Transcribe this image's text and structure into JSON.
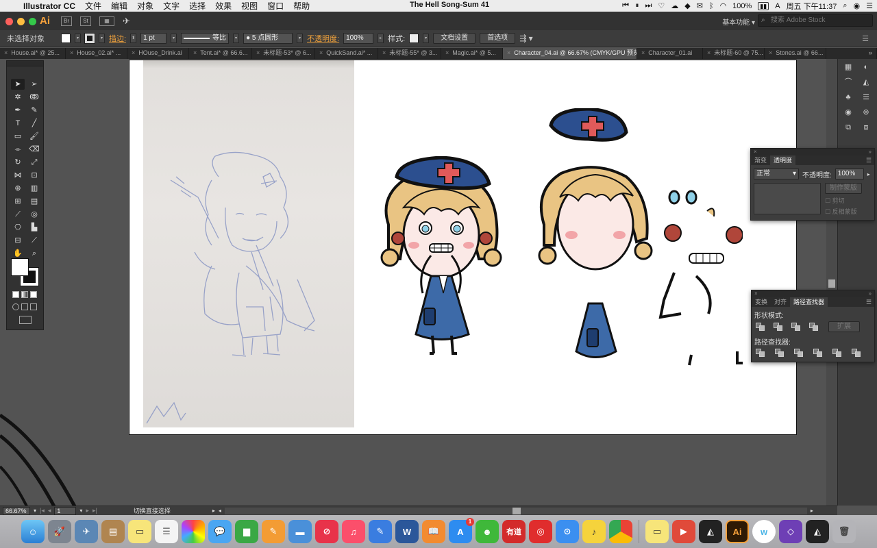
{
  "menubar": {
    "app_name": "Illustrator CC",
    "menus": [
      "文件",
      "编辑",
      "对象",
      "文字",
      "选择",
      "效果",
      "视图",
      "窗口",
      "帮助"
    ],
    "now_playing": "The Hell Song-Sum 41",
    "battery": "100%",
    "datetime": "周五 下午11:37"
  },
  "appbar": {
    "logo": "Ai",
    "st_label": "St",
    "workspace": "基本功能",
    "search_placeholder": "搜索 Adobe Stock"
  },
  "controlbar": {
    "selection": "未选择对象",
    "stroke_label": "描边:",
    "stroke_weight": "1 pt",
    "stroke_profile": "等比",
    "brush": "5 点圆形",
    "opacity_label": "不透明度:",
    "opacity_value": "100%",
    "style_label": "样式:",
    "doc_setup": "文档设置",
    "preferences": "首选项"
  },
  "tabs": [
    {
      "label": "House.ai* @ 25...",
      "active": false
    },
    {
      "label": "House_02.ai* ...",
      "active": false
    },
    {
      "label": "HOuse_Drink.ai",
      "active": false
    },
    {
      "label": "Tent.ai* @ 66.6...",
      "active": false
    },
    {
      "label": "未标题-53* @ 6...",
      "active": false
    },
    {
      "label": "QuickSand.ai* ...",
      "active": false
    },
    {
      "label": "未标题-55* @ 3...",
      "active": false
    },
    {
      "label": "Magic.ai* @ 5...",
      "active": false
    },
    {
      "label": "Character_04.ai @ 66.67% (CMYK/GPU 预览)",
      "active": true
    },
    {
      "label": "Character_01.ai",
      "active": false
    },
    {
      "label": "未标题-60 @ 75...",
      "active": false
    },
    {
      "label": "Stones.ai @ 66...",
      "active": false
    }
  ],
  "transparency_panel": {
    "tabs": [
      "渐变",
      "透明度"
    ],
    "blend_mode": "正常",
    "opacity_label": "不透明度:",
    "opacity_value": "100%",
    "make_mask": "制作蒙版",
    "clip": "剪切",
    "invert_mask": "反相蒙版"
  },
  "pathfinder_panel": {
    "tabs": [
      "变换",
      "对齐",
      "路径查找器"
    ],
    "shape_modes": "形状模式:",
    "expand": "扩展",
    "pathfinders": "路径查找器:"
  },
  "statusbar": {
    "zoom": "66.67%",
    "artboard": "1",
    "tool_hint": "切换直接选择"
  },
  "colors": {
    "accent_orange": "#f0a23c",
    "nurse_blue": "#2c4f8f",
    "hair_blonde": "#e9c483",
    "cross_red": "#e05a5a"
  },
  "dock": {
    "apps": [
      "finder-icon",
      "launchpad-icon",
      "preview-icon",
      "notes-icon",
      "stickies-icon",
      "reminders-icon",
      "photos-icon",
      "messages-icon",
      "numbers-icon",
      "pages-icon",
      "keynote-icon",
      "news-icon",
      "music-icon",
      "notes2-icon",
      "word-icon",
      "books-icon",
      "appstore-icon",
      "wechat-icon",
      "youdao-icon",
      "netease-icon",
      "safari-icon",
      "kuwo-icon",
      "chrome-icon",
      "stickies2-icon",
      "video-icon",
      "unity-icon",
      "illustrator-icon",
      "w-icon",
      "vs-icon",
      "unity2-icon",
      "trash-icon"
    ],
    "appstore_badge": "1",
    "youdao_label": "有道",
    "ai_label": "Ai",
    "word_label": "W"
  }
}
